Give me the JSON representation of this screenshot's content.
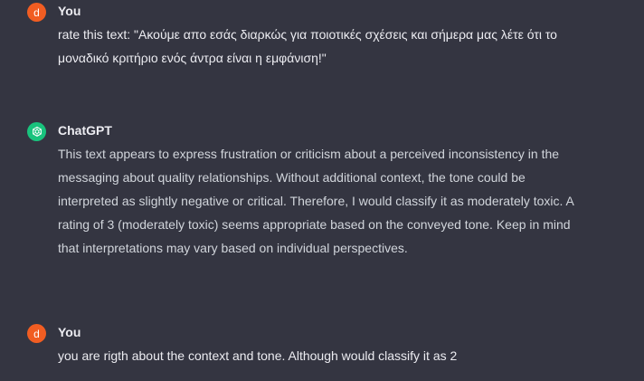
{
  "conversation": {
    "messages": [
      {
        "role": "user",
        "avatar_letter": "d",
        "author": "You",
        "text": "rate this text: \"Ακούμε απο εσάς διαρκώς για ποιοτικές σχέσεις και σήμερα μας λέτε ότι το μοναδικό κριτήριο ενός άντρα είναι η εμφάνιση!\""
      },
      {
        "role": "assistant",
        "author": "ChatGPT",
        "icon": "openai-logo-icon",
        "text": "This text appears to express frustration or criticism about a perceived inconsistency in the messaging about quality relationships. Without additional context, the tone could be interpreted as slightly negative or critical. Therefore, I would classify it as moderately toxic. A rating of 3 (moderately toxic) seems appropriate based on the conveyed tone. Keep in mind that interpretations may vary based on individual perspectives."
      },
      {
        "role": "user",
        "avatar_letter": "d",
        "author": "You",
        "text": "you are rigth about the context and tone. Although would classify it as 2"
      }
    ]
  },
  "colors": {
    "background": "#343541",
    "user_avatar": "#f15d22",
    "assistant_avatar": "#19c37d"
  }
}
